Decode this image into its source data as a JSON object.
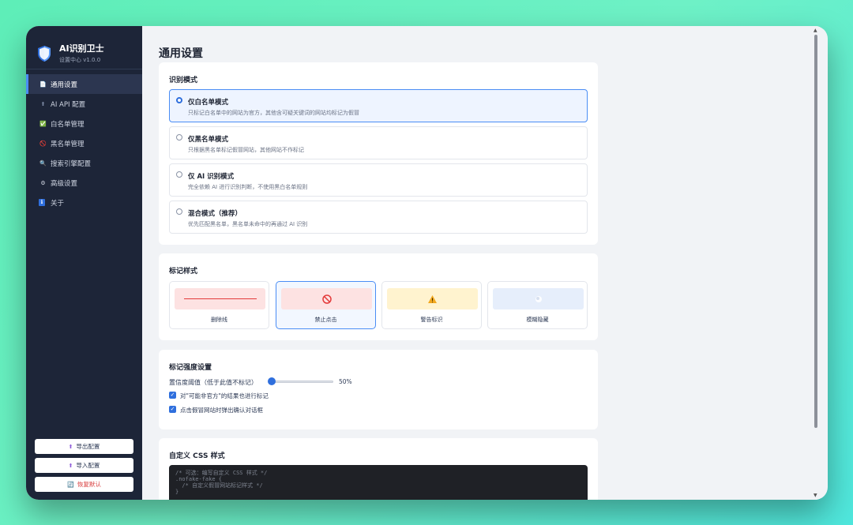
{
  "sidebar": {
    "title": "AI识别卫士",
    "subtitle": "设置中心 v1.0.0",
    "items": [
      {
        "icon": "📄",
        "label": "通用设置"
      },
      {
        "icon": "⬆",
        "label": "AI API 配置"
      },
      {
        "icon": "✅",
        "label": "白名单管理"
      },
      {
        "icon": "🚫",
        "label": "黑名单管理"
      },
      {
        "icon": "🔍",
        "label": "搜索引擎配置"
      },
      {
        "icon": "⚙",
        "label": "高级设置"
      },
      {
        "icon": "ℹ",
        "label": "关于"
      }
    ],
    "buttons": {
      "export": {
        "icon": "⬆",
        "label": "导出配置"
      },
      "import": {
        "icon": "⬆",
        "label": "导入配置"
      },
      "reset": {
        "icon": "🔄",
        "label": "恢复默认"
      }
    }
  },
  "main": {
    "page_title": "通用设置",
    "mode_section": {
      "title": "识别模式",
      "options": [
        {
          "title": "仅白名单模式",
          "desc": "只标记白名单中的网站为官方，其他含可疑关键词的网站均标记为假冒",
          "selected": true
        },
        {
          "title": "仅黑名单模式",
          "desc": "只根据黑名单标记假冒网站，其他网站不作标记",
          "selected": false
        },
        {
          "title": "仅 AI 识别模式",
          "desc": "完全依赖 AI 进行识别判断，不使用黑白名单规则",
          "selected": false
        },
        {
          "title": "混合模式（推荐）",
          "desc": "优先匹配黑名单，黑名单未命中的再通过 AI 识别",
          "selected": false
        }
      ]
    },
    "style_section": {
      "title": "标记样式",
      "options": [
        {
          "label": "删除线",
          "preview_bg": "#fde2e2",
          "selected": false
        },
        {
          "label": "禁止点击",
          "icon": "🚫",
          "preview_bg": "#fde2e2",
          "selected": true
        },
        {
          "label": "警告标识",
          "icon": "⚠",
          "preview_bg": "#fff3cf",
          "selected": false
        },
        {
          "label": "模糊隐藏",
          "icon": "🕊",
          "preview_bg": "#e6eefb",
          "selected": false
        }
      ]
    },
    "strength_section": {
      "title": "标记强度设置",
      "threshold_label": "置信度阈值（低于此值不标记）",
      "threshold_value": 0.5,
      "threshold_display": "50%",
      "check1": {
        "label": "对\"可能非官方\"的结果也进行标记",
        "checked": true
      },
      "check2": {
        "label": "点击假冒网站时弹出确认对话框",
        "checked": true
      }
    },
    "css_section": {
      "title": "自定义 CSS 样式",
      "code_lines": [
        "/* 可选：编写自定义 CSS 样式 */",
        ".nofake-fake {",
        "  /* 自定义假冒网站标记样式 */",
        "}"
      ]
    }
  },
  "colors": {
    "accent": "#2f6fdd",
    "sidebar_bg": "#1d2538",
    "danger": "#d83a3a"
  }
}
